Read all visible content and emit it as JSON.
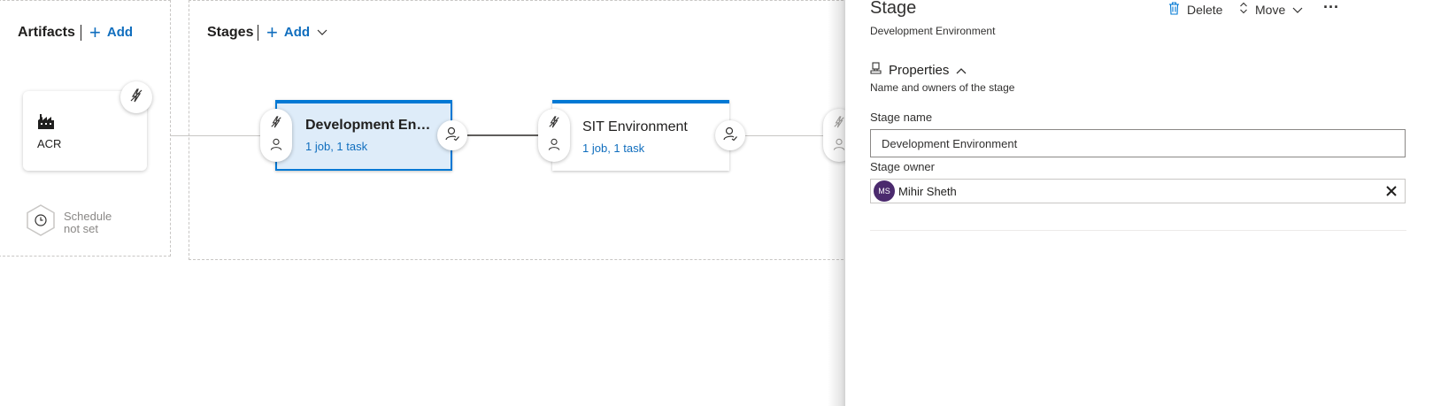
{
  "pipeline": {
    "artifacts": {
      "title": "Artifacts",
      "add_label": "Add",
      "items": [
        {
          "name": "ACR",
          "icon": "factory-icon"
        }
      ],
      "schedule": {
        "line1": "Schedule",
        "line2": "not set"
      }
    },
    "stages": {
      "title": "Stages",
      "add_label": "Add",
      "items": [
        {
          "name": "Development Envi...",
          "summary": "1 job, 1 task",
          "selected": true
        },
        {
          "name": "SIT Environment",
          "summary": "1 job, 1 task",
          "selected": false
        }
      ]
    }
  },
  "panel": {
    "title": "Stage",
    "subtitle": "Development Environment",
    "toolbar": {
      "delete_label": "Delete",
      "move_label": "Move",
      "more_label": "···"
    },
    "properties": {
      "title": "Properties",
      "description": "Name and owners of the stage",
      "stage_name_label": "Stage name",
      "stage_name_value": "Development Environment",
      "stage_owner_label": "Stage owner",
      "owner": {
        "initials": "MS",
        "name": "Mihir Sheth"
      }
    }
  },
  "colors": {
    "accent": "#0078d4",
    "link": "#106ebe",
    "selected_bg": "#deecf9",
    "avatar": "#4b2a6e"
  }
}
